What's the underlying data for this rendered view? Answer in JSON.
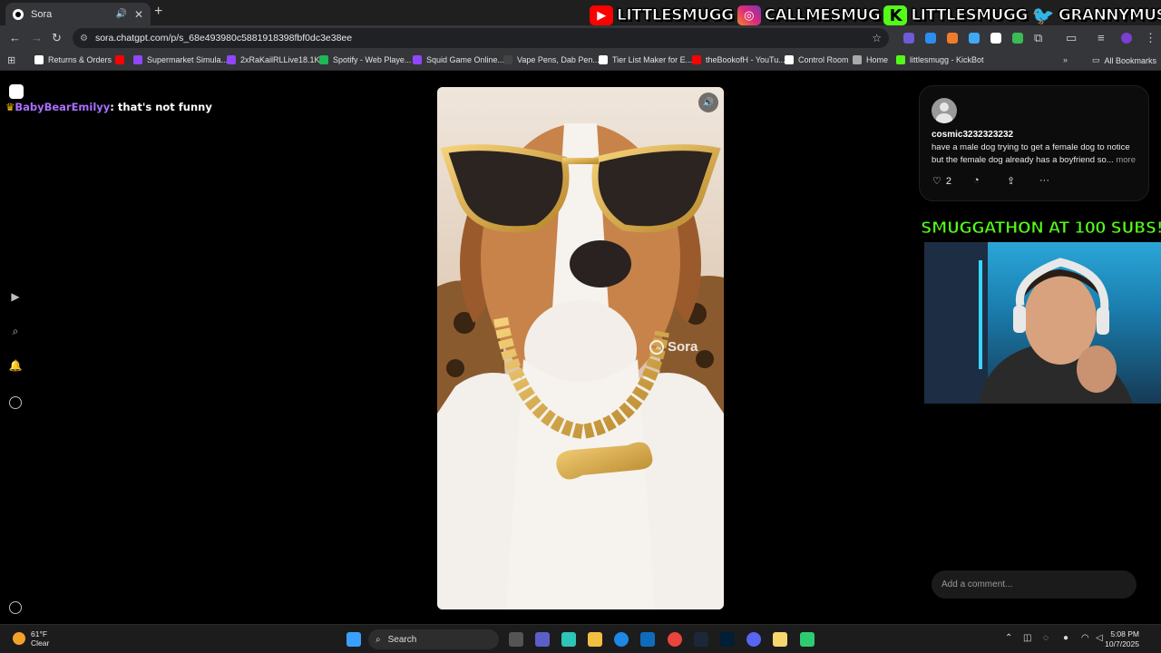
{
  "browser": {
    "tab_title": "Sora",
    "url": "sora.chatgpt.com/p/s_68e493980c5881918398fbf0dc3e38ee",
    "bookmarks": [
      {
        "label": "Returns & Orders",
        "color": "#ffffff"
      },
      {
        "label": "",
        "color": "#ff0000"
      },
      {
        "label": "Supermarket Simula...",
        "color": "#9146ff"
      },
      {
        "label": "2xRaKailRLLive18.1K...",
        "color": "#9146ff"
      },
      {
        "label": "Spotify - Web Playe...",
        "color": "#1db954"
      },
      {
        "label": "Squid Game Online...",
        "color": "#9146ff"
      },
      {
        "label": "Vape Pens, Dab Pen...",
        "color": "#444444"
      },
      {
        "label": "Tier List Maker for E...",
        "color": "#ffffff"
      },
      {
        "label": "theBookofH - YouTu...",
        "color": "#ff0000"
      },
      {
        "label": "Control Room",
        "color": "#ffffff"
      },
      {
        "label": "Home",
        "color": "#aaaaaa"
      },
      {
        "label": "littlesmugg - KickBot",
        "color": "#53fc18"
      }
    ],
    "all_bookmarks": "All Bookmarks"
  },
  "social_banner": {
    "youtube": "LITTLESMUGG",
    "instagram": "CALLMESMUG",
    "kick": "LITTLESMUGG",
    "twitter": "GRANNYMUSLIM"
  },
  "chat": {
    "username": "BabyBearEmilyy",
    "message": ": that's not funny"
  },
  "video": {
    "watermark": "Sora"
  },
  "post": {
    "username": "cosmic3232323232",
    "caption": "have a male dog trying to get a female dog to notice but the female dog already has a boyfriend so...",
    "more": "more",
    "likes": "2",
    "comment_placeholder": "Add a comment..."
  },
  "stream_overlay": {
    "title": "SMUGGATHON AT 100 SUBS!"
  },
  "taskbar": {
    "temp": "61°F",
    "condition": "Clear",
    "search": "Search",
    "time": "5:08 PM",
    "date": "10/7/2025"
  }
}
